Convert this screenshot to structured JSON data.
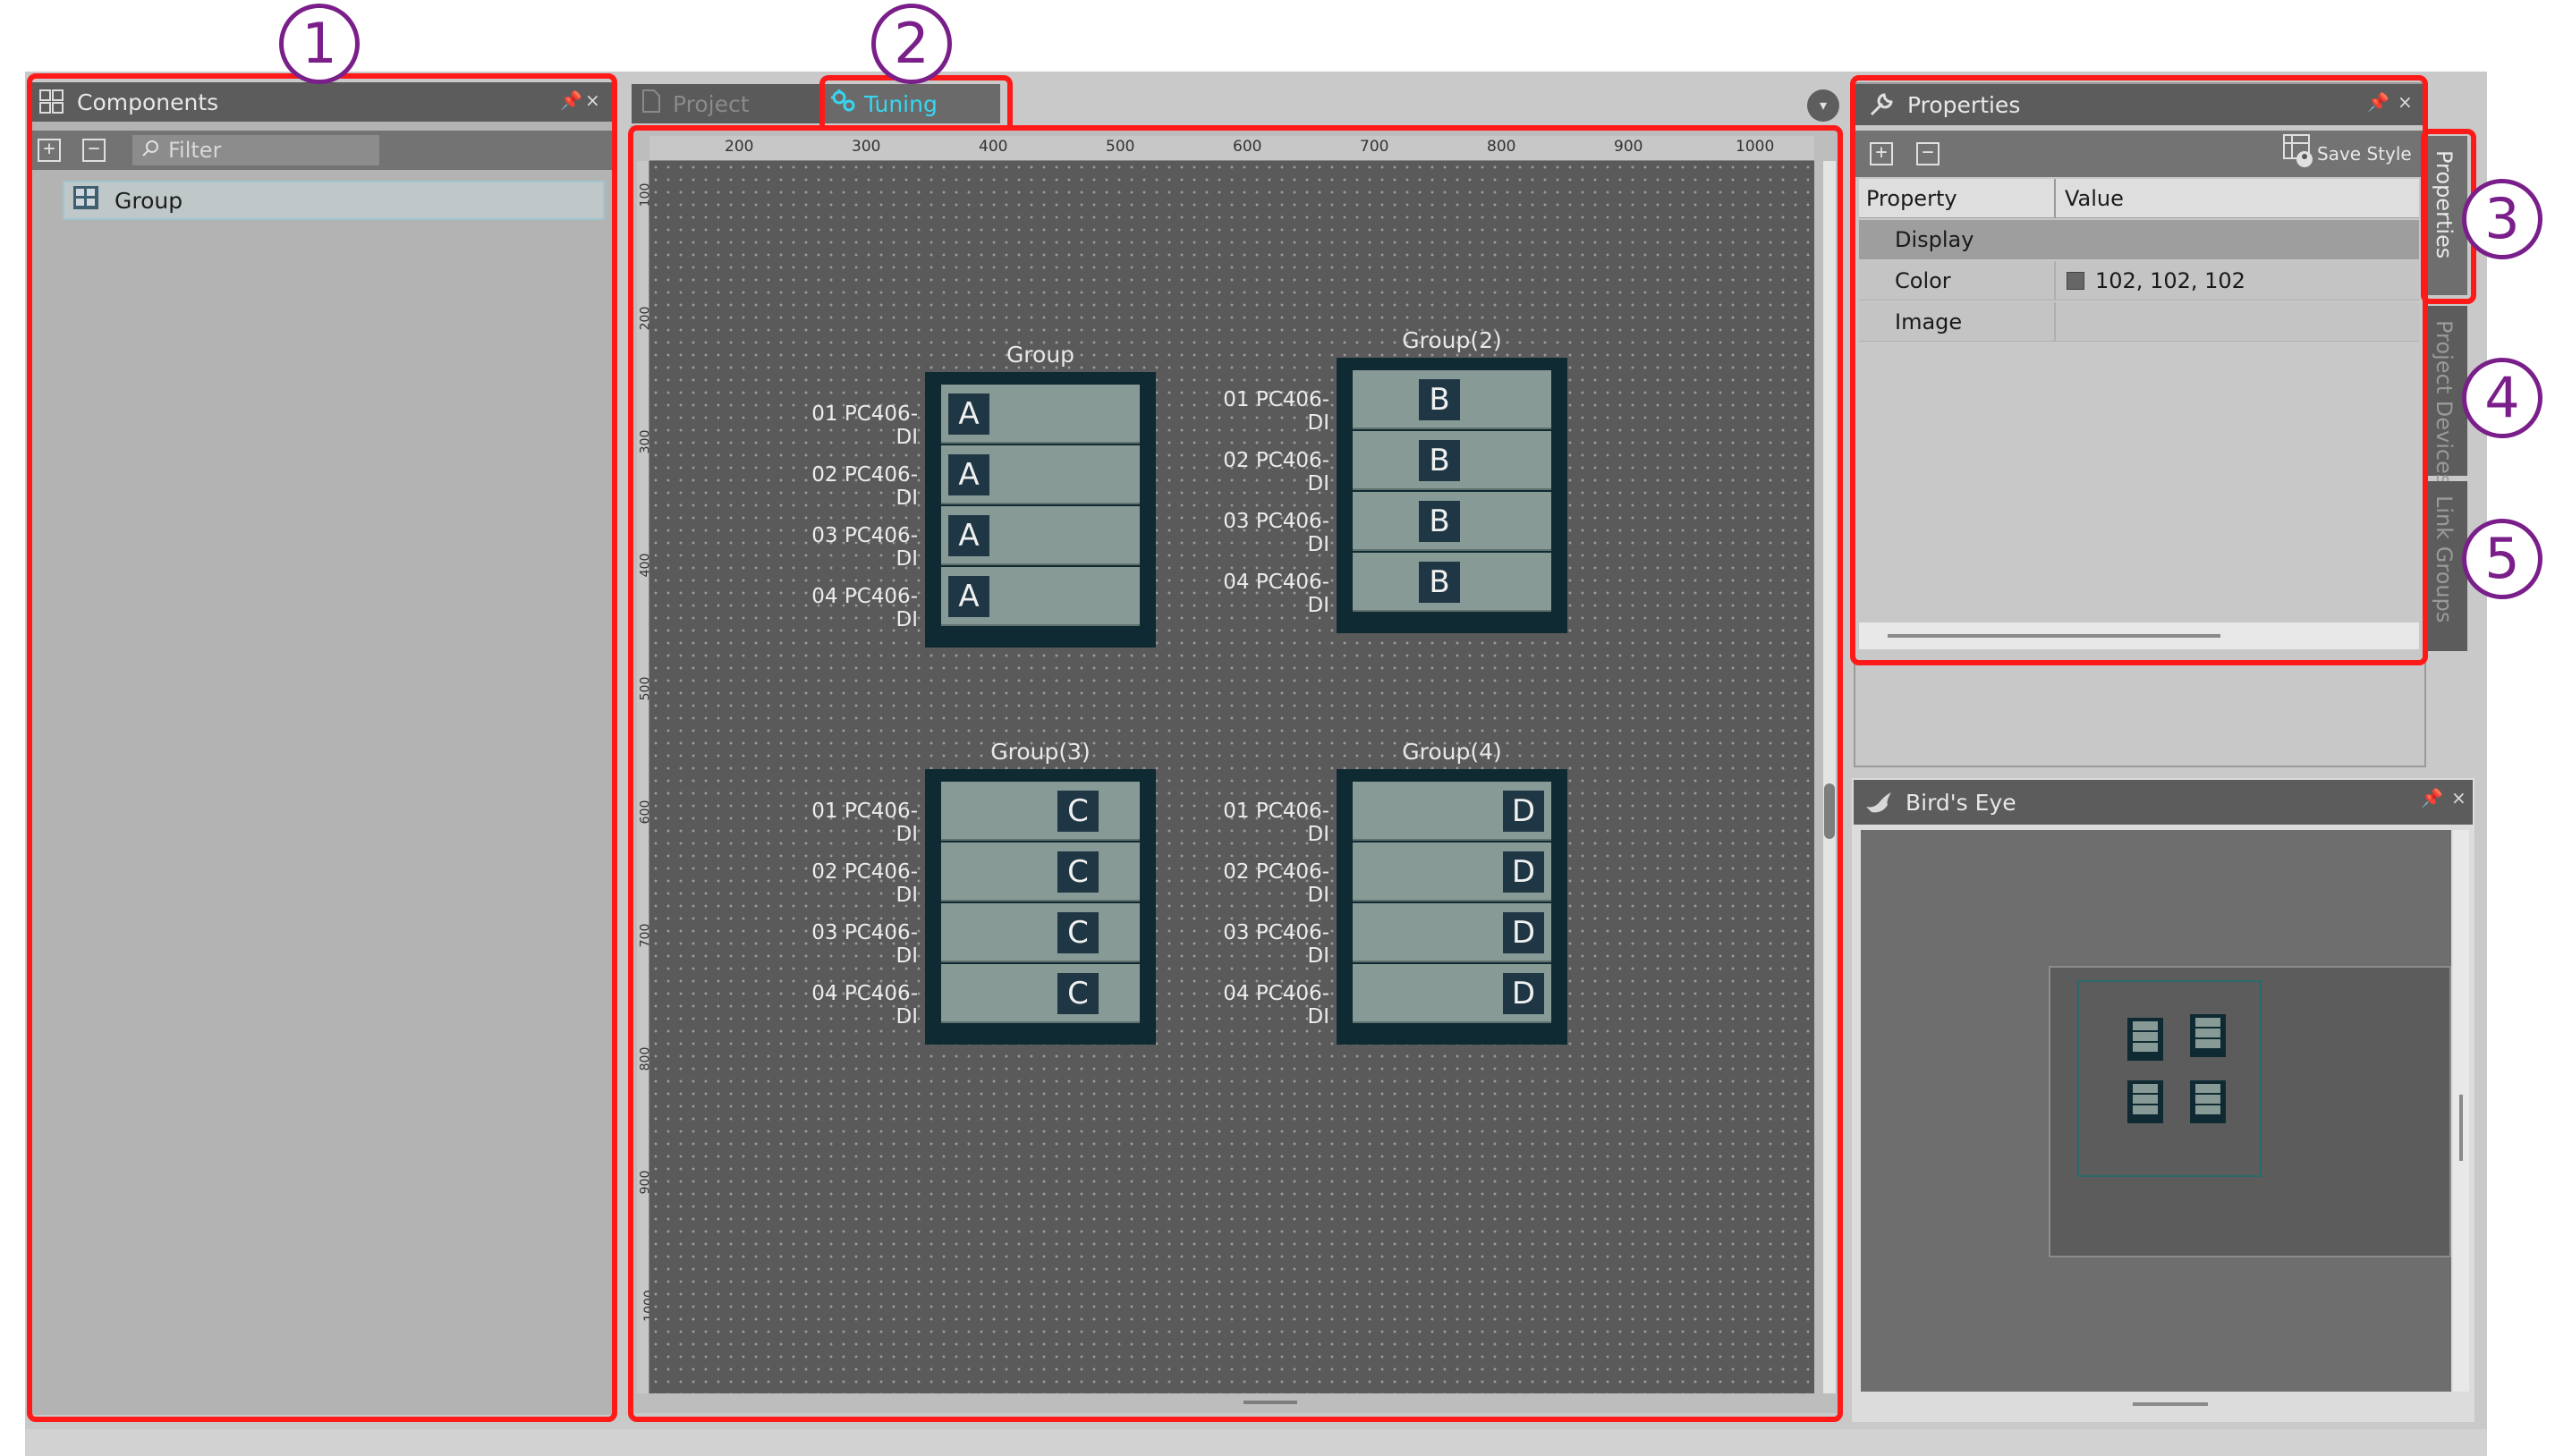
{
  "components": {
    "title": "Components",
    "pin_glyph": "📌",
    "close_glyph": "×",
    "expand_glyph": "+",
    "collapse_glyph": "−",
    "filter_placeholder": "Filter",
    "tree": [
      {
        "label": "Group"
      }
    ]
  },
  "tabs": [
    {
      "label": "Project",
      "active": false
    },
    {
      "label": "Tuning",
      "active": true
    }
  ],
  "tabs_dropdown_glyph": "▾",
  "ruler": {
    "x_labels": [
      "200",
      "300",
      "400",
      "500",
      "600",
      "700",
      "800",
      "900",
      "1000"
    ],
    "y_labels": [
      "100",
      "200",
      "300",
      "400",
      "500",
      "600",
      "700",
      "800",
      "900",
      "1000"
    ]
  },
  "groups": [
    {
      "title": "Group",
      "badge": "A",
      "badge_side": "left",
      "devices": [
        "01 PC406-DI",
        "02 PC406-DI",
        "03 PC406-DI",
        "04 PC406-DI"
      ]
    },
    {
      "title": "Group(2)",
      "badge": "B",
      "badge_side": "left",
      "devices": [
        "01 PC406-DI",
        "02 PC406-DI",
        "03 PC406-DI",
        "04 PC406-DI"
      ]
    },
    {
      "title": "Group(3)",
      "badge": "C",
      "badge_side": "right",
      "devices": [
        "01 PC406-DI",
        "02 PC406-DI",
        "03 PC406-DI",
        "04 PC406-DI"
      ]
    },
    {
      "title": "Group(4)",
      "badge": "D",
      "badge_side": "right",
      "devices": [
        "01 PC406-DI",
        "02 PC406-DI",
        "03 PC406-DI",
        "04 PC406-DI"
      ]
    }
  ],
  "properties": {
    "title": "Properties",
    "save_style": "Save Style",
    "col_property": "Property",
    "col_value": "Value",
    "rows": [
      {
        "type": "category",
        "label": "Display",
        "value": ""
      },
      {
        "type": "property",
        "label": "Color",
        "value": "102, 102, 102",
        "swatch": "#666666"
      },
      {
        "type": "property",
        "label": "Image",
        "value": ""
      }
    ]
  },
  "side_tabs": [
    "Properties",
    "Project Devices",
    "Link Groups"
  ],
  "birds_eye": {
    "title": "Bird's Eye"
  },
  "callouts": [
    "1",
    "2",
    "3",
    "4",
    "5"
  ],
  "colors": {
    "highlight": "#ff1a1a",
    "callout": "#7a1f8a",
    "active_tab": "#38d6f0",
    "group_frame": "#0f2a33",
    "slot": "#879a96",
    "badge": "#1f3744"
  }
}
